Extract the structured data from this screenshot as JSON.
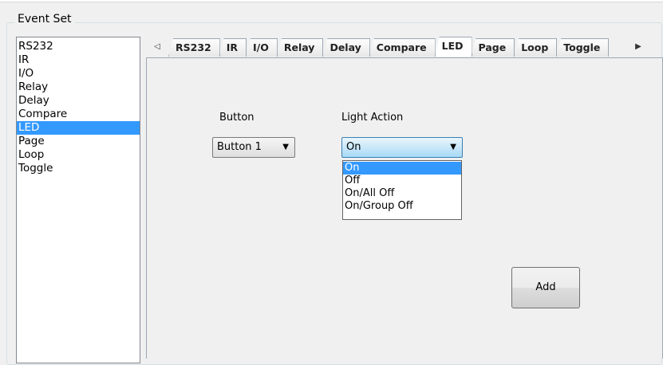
{
  "group_title": "Event Set",
  "event_list": {
    "items": [
      "RS232",
      "IR",
      "I/O",
      "Relay",
      "Delay",
      "Compare",
      "LED",
      "Page",
      "Loop",
      "Toggle"
    ],
    "selected": "LED"
  },
  "tabs": {
    "items": [
      "RS232",
      "IR",
      "I/O",
      "Relay",
      "Delay",
      "Compare",
      "LED",
      "Page",
      "Loop",
      "Toggle"
    ],
    "active": "LED"
  },
  "led_panel": {
    "button_label": "Button",
    "button_value": "Button 1",
    "light_action_label": "Light Action",
    "light_action_value": "On",
    "light_action_options": [
      "On",
      "Off",
      "On/All Off",
      "On/Group Off"
    ],
    "add_label": "Add"
  },
  "colors": {
    "selection": "#3399ff",
    "combo_open": "#a7d9f5"
  }
}
